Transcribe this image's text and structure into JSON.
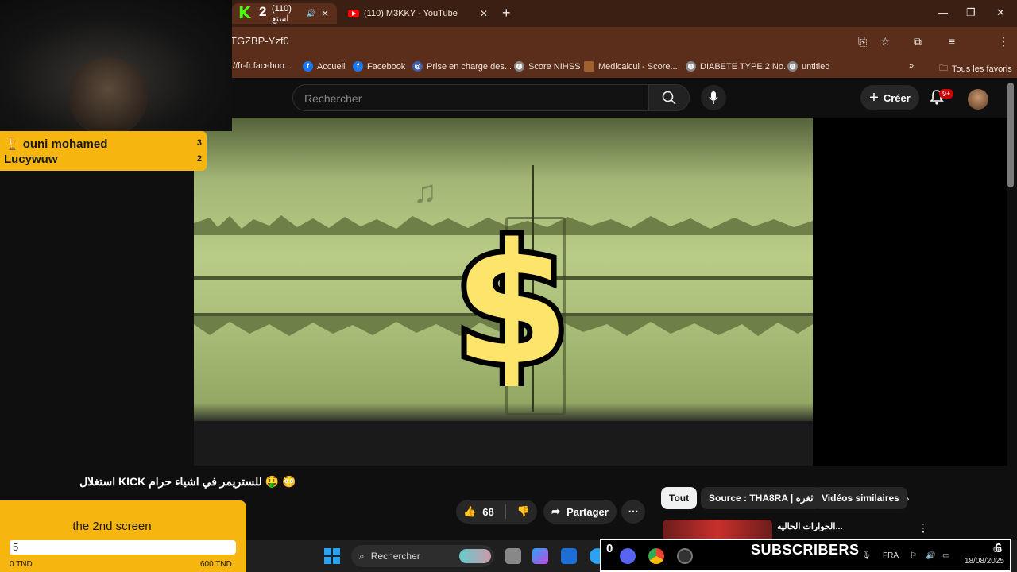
{
  "browser": {
    "tabs": [
      {
        "title": "(110) استغ",
        "active": true
      },
      {
        "title": "(110) M3KKY - YouTube",
        "active": false
      }
    ],
    "url_fragment": "TGZBP-Yzf0",
    "bookmarks": [
      {
        "label": "://fr-fr.faceboo...",
        "icon": "link-icon"
      },
      {
        "label": "Accueil",
        "icon": "facebook-icon"
      },
      {
        "label": "Facebook",
        "icon": "facebook-icon"
      },
      {
        "label": "Prise en charge des...",
        "icon": "globe-icon"
      },
      {
        "label": "Score NIHSS",
        "icon": "globe-icon"
      },
      {
        "label": "Medicalcul - Score...",
        "icon": "page-icon"
      },
      {
        "label": "DIABETE TYPE 2 No...",
        "icon": "globe-icon"
      },
      {
        "label": "untitled",
        "icon": "globe-icon"
      }
    ],
    "all_bookmarks": "Tous les favoris"
  },
  "youtube": {
    "search_placeholder": "Rechercher",
    "create_label": "Créer",
    "notification_count": "9+",
    "video_title": "استغلال KICK للستريمر في اشياء حرام 🤑 😳",
    "like_count": "68",
    "share_label": "Partager",
    "chips": [
      "Tout",
      "Source : THA8RA | ثغره",
      "Vidéos similaires"
    ],
    "suggestion_title": "الحوارات الحاليه..."
  },
  "overlay": {
    "kick_count": "2",
    "leaderboard": [
      {
        "name": "ouni mohamed",
        "score": "3"
      },
      {
        "name": "Lucywuw",
        "score": "2"
      }
    ],
    "goal": {
      "title": "the 2nd screen",
      "current": "5",
      "min_label": "0 TND",
      "max_label": "600 TND",
      "progress_fraction": 0.008
    },
    "subscribers_label": "SUBSCRIBERS",
    "subscribers_prefix": "0",
    "subscribers_count": "6"
  },
  "taskbar": {
    "search_label": "Rechercher",
    "language": "FRA",
    "time": "06:",
    "date": "18/08/2025"
  },
  "colors": {
    "accent_yellow": "#f7b50f",
    "kick_green": "#53fc18",
    "browser_chrome": "#5a2e1a"
  }
}
